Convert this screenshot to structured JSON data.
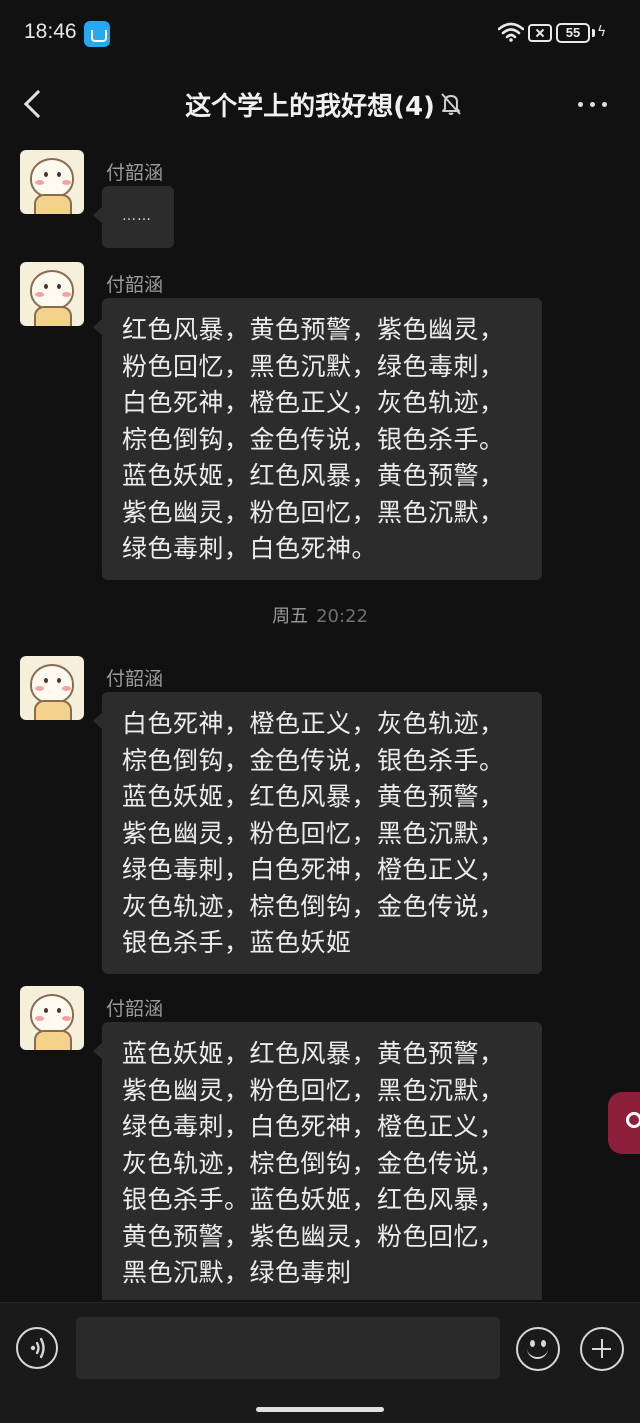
{
  "status_bar": {
    "time": "18:46",
    "app_icon": "bag-icon",
    "battery_level": "55",
    "battery_percent": 55
  },
  "header": {
    "title": "这个学上的我好想(4)",
    "muted": true
  },
  "messages": [
    {
      "sender": "付韶涵",
      "text": "……"
    },
    {
      "sender": "付韶涵",
      "text": "红色风暴，黄色预警，紫色幽灵，\n粉色回忆，黑色沉默，绿色毒刺，\n白色死神，橙色正义，灰色轨迹，\n棕色倒钩，金色传说，银色杀手。\n蓝色妖姬，红色风暴，黄色预警，\n紫色幽灵，粉色回忆，黑色沉默，\n绿色毒刺，白色死神。"
    },
    {
      "sender": "付韶涵",
      "text": "白色死神，橙色正义，灰色轨迹，\n棕色倒钩，金色传说，银色杀手。\n蓝色妖姬，红色风暴，黄色预警，\n紫色幽灵，粉色回忆，黑色沉默，\n绿色毒刺，白色死神，橙色正义，\n灰色轨迹，棕色倒钩，金色传说，\n银色杀手，蓝色妖姬"
    },
    {
      "sender": "付韶涵",
      "text": "蓝色妖姬，红色风暴，黄色预警，\n紫色幽灵，粉色回忆，黑色沉默，\n绿色毒刺，白色死神，橙色正义，\n灰色轨迹，棕色倒钩，金色传说，\n银色杀手。蓝色妖姬，红色风暴，\n黄色预警，紫色幽灵，粉色回忆，\n黑色沉默，绿色毒刺"
    }
  ],
  "timestamp": {
    "day": "周五",
    "time": "20:22"
  },
  "input": {
    "value": "",
    "placeholder": ""
  },
  "colors": {
    "background": "#111111",
    "bubble": "#2c2c2c",
    "accent_tab": "#8c1f3a"
  }
}
